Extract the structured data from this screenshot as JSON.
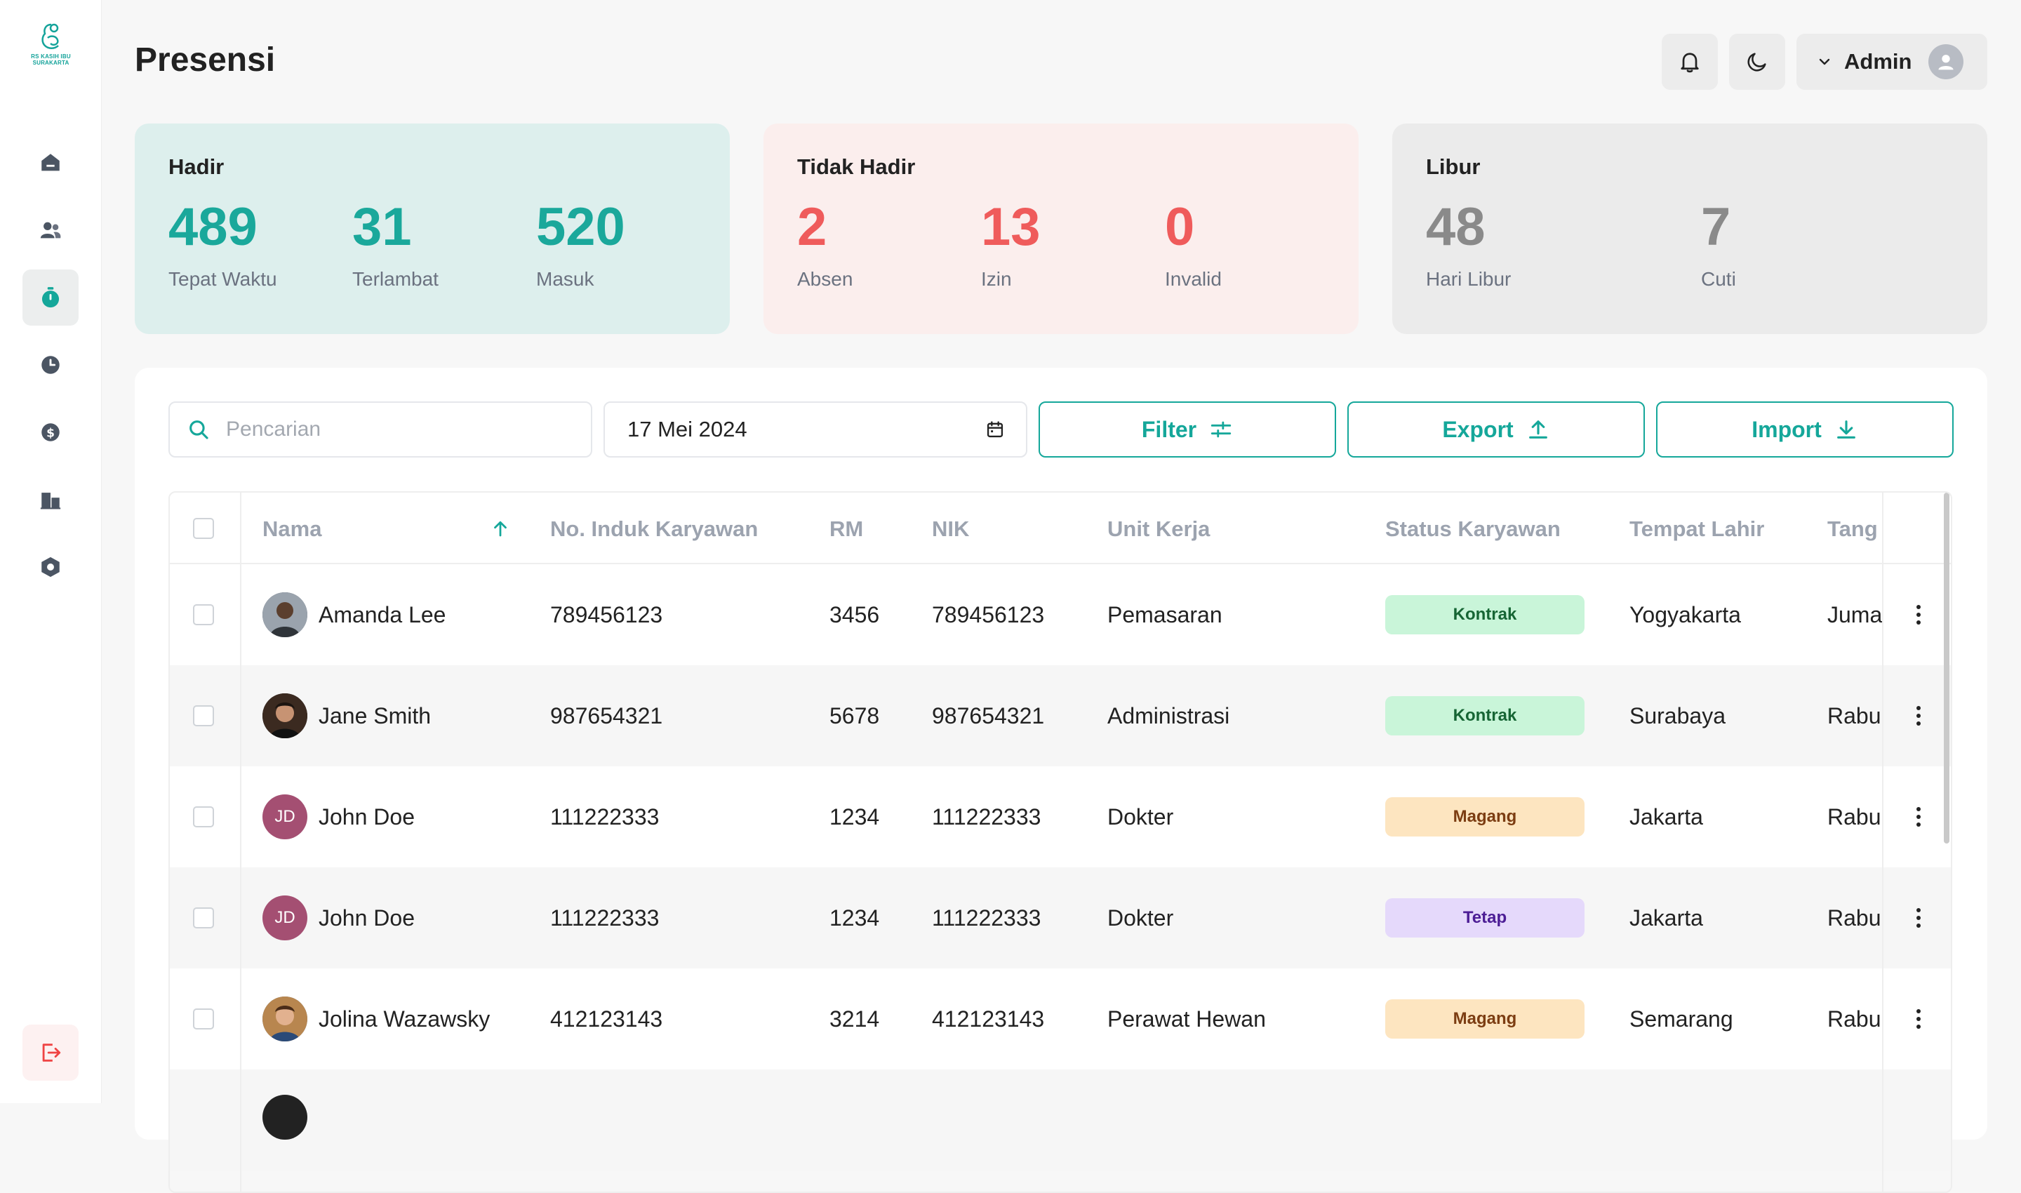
{
  "app": {
    "logo_text_line1": "RS KASIH IBU",
    "logo_text_line2": "SURAKARTA",
    "page_title": "Presensi"
  },
  "sidebar": {
    "items": [
      {
        "icon": "home-icon",
        "active": false
      },
      {
        "icon": "users-icon",
        "active": false
      },
      {
        "icon": "stopwatch-icon",
        "active": true
      },
      {
        "icon": "clock-icon",
        "active": false
      },
      {
        "icon": "dollar-icon",
        "active": false
      },
      {
        "icon": "building-icon",
        "active": false
      },
      {
        "icon": "hexagon-settings-icon",
        "active": false
      }
    ],
    "logout_icon": "logout-icon"
  },
  "header": {
    "notification_icon": "bell-icon",
    "theme_icon": "moon-icon",
    "user_label": "Admin"
  },
  "stats": {
    "hadir": {
      "title": "Hadir",
      "items": [
        {
          "value": "489",
          "label": "Tepat Waktu"
        },
        {
          "value": "31",
          "label": "Terlambat"
        },
        {
          "value": "520",
          "label": "Masuk"
        }
      ]
    },
    "tidak_hadir": {
      "title": "Tidak Hadir",
      "items": [
        {
          "value": "2",
          "label": "Absen"
        },
        {
          "value": "13",
          "label": "Izin"
        },
        {
          "value": "0",
          "label": "Invalid"
        }
      ]
    },
    "libur": {
      "title": "Libur",
      "items": [
        {
          "value": "48",
          "label": "Hari Libur"
        },
        {
          "value": "7",
          "label": "Cuti"
        }
      ]
    }
  },
  "toolbar": {
    "search_placeholder": "Pencarian",
    "date_value": "17 Mei 2024",
    "filter_label": "Filter",
    "export_label": "Export",
    "import_label": "Import"
  },
  "table": {
    "columns": {
      "nama": "Nama",
      "no_induk": "No. Induk Karyawan",
      "rm": "RM",
      "nik": "NIK",
      "unit": "Unit Kerja",
      "status": "Status Karyawan",
      "tempat": "Tempat Lahir",
      "tanggal": "Tang"
    },
    "rows": [
      {
        "initials": "",
        "nama": "Amanda Lee",
        "no_induk": "789456123",
        "rm": "3456",
        "nik": "789456123",
        "unit": "Pemasaran",
        "status": "Kontrak",
        "tempat": "Yogyakarta",
        "tanggal": "Juma"
      },
      {
        "initials": "",
        "nama": "Jane Smith",
        "no_induk": "987654321",
        "rm": "5678",
        "nik": "987654321",
        "unit": "Administrasi",
        "status": "Kontrak",
        "tempat": "Surabaya",
        "tanggal": "Rabu"
      },
      {
        "initials": "JD",
        "nama": "John Doe",
        "no_induk": "111222333",
        "rm": "1234",
        "nik": "111222333",
        "unit": "Dokter",
        "status": "Magang",
        "tempat": "Jakarta",
        "tanggal": "Rabu"
      },
      {
        "initials": "JD",
        "nama": "John Doe",
        "no_induk": "111222333",
        "rm": "1234",
        "nik": "111222333",
        "unit": "Dokter",
        "status": "Tetap",
        "tempat": "Jakarta",
        "tanggal": "Rabu"
      },
      {
        "initials": "",
        "nama": "Jolina Wazawsky",
        "no_induk": "412123143",
        "rm": "3214",
        "nik": "412123143",
        "unit": "Perawat Hewan",
        "status": "Magang",
        "tempat": "Semarang",
        "tanggal": "Rabu"
      }
    ]
  },
  "colors": {
    "accent": "#15a79a",
    "hadir_bg": "#ddefed",
    "tidak_hadir_bg": "#fbeeed",
    "libur_bg": "#ebebeb",
    "hadir_value": "#1aa89b",
    "tidak_hadir_value": "#ef5b5b",
    "libur_value": "#8a8a8a",
    "badge_kontrak_bg": "#c9f5d9",
    "badge_kontrak_text": "#166534",
    "badge_magang_bg": "#fde5c0",
    "badge_magang_text": "#7c3d12",
    "badge_tetap_bg": "#e5d9fb",
    "badge_tetap_text": "#4c1d95"
  }
}
